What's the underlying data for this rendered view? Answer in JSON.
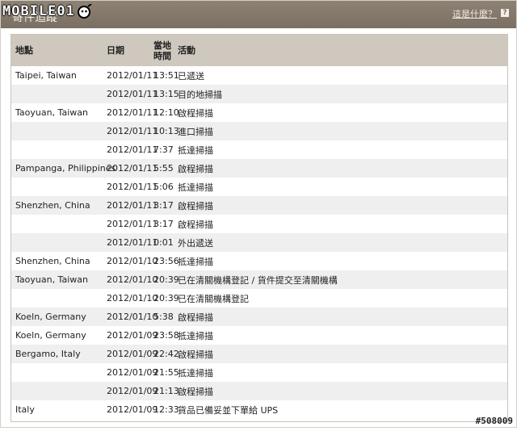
{
  "logo": {
    "text": "MOBILE01"
  },
  "header": {
    "title": "寄件追蹤",
    "help_link": "這是什麼？",
    "help_icon": "?"
  },
  "table": {
    "columns": {
      "location": "地點",
      "date": "日期",
      "time": "當地時間",
      "activity": "活動"
    },
    "rows": [
      {
        "location": "Taipei, Taiwan",
        "date": "2012/01/11",
        "time": "13:51",
        "activity": "已遞送"
      },
      {
        "location": "",
        "date": "2012/01/11",
        "time": "13:15",
        "activity": "目的地掃描"
      },
      {
        "location": "Taoyuan, Taiwan",
        "date": "2012/01/11",
        "time": "12:10",
        "activity": "啟程掃描"
      },
      {
        "location": "",
        "date": "2012/01/11",
        "time": "10:13",
        "activity": "進口掃描"
      },
      {
        "location": "",
        "date": "2012/01/11",
        "time": "7:37",
        "activity": "抵達掃描"
      },
      {
        "location": "Pampanga, Philippines",
        "date": "2012/01/11",
        "time": "5:55",
        "activity": "啟程掃描"
      },
      {
        "location": "",
        "date": "2012/01/11",
        "time": "5:06",
        "activity": "抵達掃描"
      },
      {
        "location": "Shenzhen, China",
        "date": "2012/01/11",
        "time": "3:17",
        "activity": "啟程掃描"
      },
      {
        "location": "",
        "date": "2012/01/11",
        "time": "3:17",
        "activity": "啟程掃描"
      },
      {
        "location": "",
        "date": "2012/01/11",
        "time": "0:01",
        "activity": "外出遞送"
      },
      {
        "location": "Shenzhen, China",
        "date": "2012/01/10",
        "time": "23:56",
        "activity": "抵達掃描"
      },
      {
        "location": "Taoyuan, Taiwan",
        "date": "2012/01/10",
        "time": "20:39",
        "activity": "已在清關機構登記 / 貨件提交至清關機構"
      },
      {
        "location": "",
        "date": "2012/01/10",
        "time": "20:39",
        "activity": "已在清關機構登記"
      },
      {
        "location": "Koeln, Germany",
        "date": "2012/01/10",
        "time": "5:38",
        "activity": "啟程掃描"
      },
      {
        "location": "Koeln, Germany",
        "date": "2012/01/09",
        "time": "23:58",
        "activity": "抵達掃描"
      },
      {
        "location": "Bergamo, Italy",
        "date": "2012/01/09",
        "time": "22:42",
        "activity": "啟程掃描"
      },
      {
        "location": "",
        "date": "2012/01/09",
        "time": "21:55",
        "activity": "抵達掃描"
      },
      {
        "location": "",
        "date": "2012/01/09",
        "time": "21:13",
        "activity": "啟程掃描"
      },
      {
        "location": "Italy",
        "date": "2012/01/09",
        "time": "12:33",
        "activity": "貨品已備妥並下單給 UPS"
      }
    ]
  },
  "watermark": "#508009",
  "colors": {
    "header_bg": "#7a6f62",
    "table_header_bg": "#cfc8be",
    "row_alt_bg": "#efefef"
  }
}
